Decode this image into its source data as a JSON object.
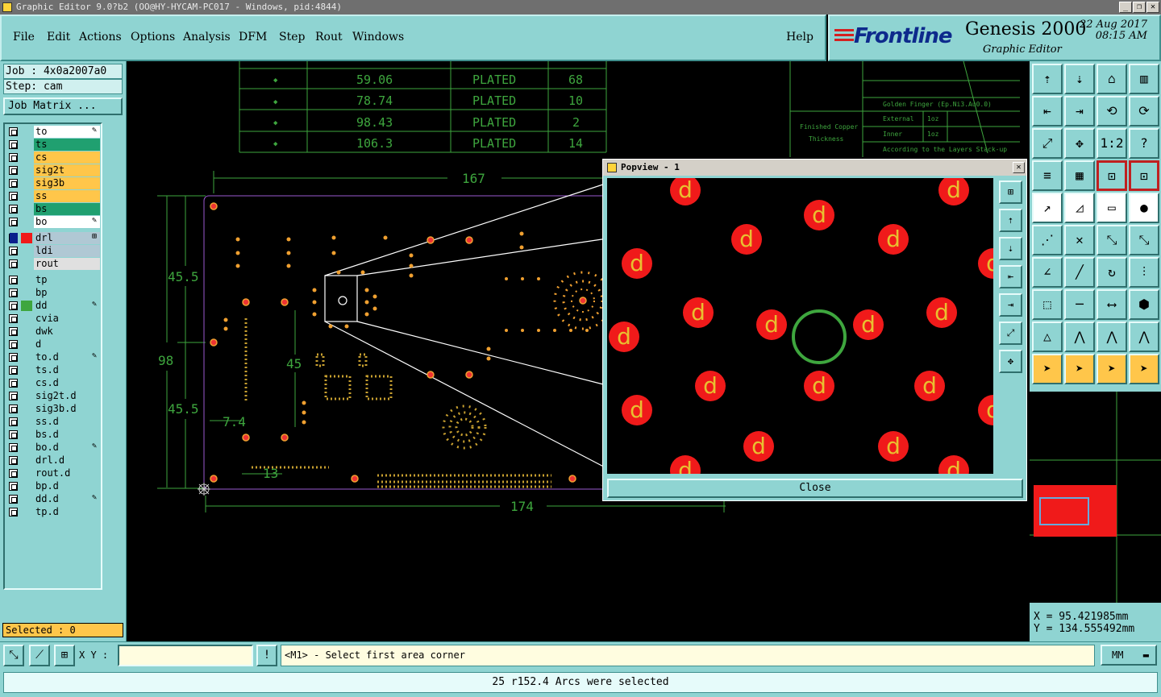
{
  "window": {
    "title": "Graphic Editor 9.0?b2 (OO@HY-HYCAM-PC017 - Windows, pid:4844)",
    "controls": [
      "_",
      "❐",
      "✕"
    ]
  },
  "menu": {
    "items": [
      "File",
      "Edit",
      "Actions",
      "Options",
      "Analysis",
      "DFM",
      "Step",
      "Rout",
      "Windows"
    ],
    "help": "Help"
  },
  "brand": {
    "logo": "Frontline",
    "product": "Genesis 2000",
    "subtitle": "Graphic Editor",
    "date": "22 Aug 2017",
    "time": "08:15 AM"
  },
  "job": {
    "job_label": "Job : 4x0a2007a0",
    "step_label": "Step: cam",
    "matrix_button": "Job Matrix ..."
  },
  "layers": [
    {
      "name": "to",
      "color": "#ffffff",
      "marker": "✎"
    },
    {
      "name": "ts",
      "color": "#20a070",
      "marker": ""
    },
    {
      "name": "cs",
      "color": "#ffc64a",
      "marker": ""
    },
    {
      "name": "sig2t",
      "color": "#ffc64a",
      "marker": ""
    },
    {
      "name": "sig3b",
      "color": "#ffc64a",
      "marker": ""
    },
    {
      "name": "ss",
      "color": "#ffc64a",
      "marker": ""
    },
    {
      "name": "bs",
      "color": "#20a070",
      "marker": ""
    },
    {
      "name": "bo",
      "color": "#ffffff",
      "marker": "✎"
    },
    {
      "name": "drl",
      "color": "#b0c8d4",
      "marker": "⊞"
    },
    {
      "name": "ldi",
      "color": "#b0c8d4",
      "marker": ""
    },
    {
      "name": "rout",
      "color": "#e0e0e0",
      "marker": ""
    },
    {
      "name": "tp",
      "color": "#8fd4d2",
      "marker": ""
    },
    {
      "name": "bp",
      "color": "#8fd4d2",
      "marker": ""
    },
    {
      "name": "dd",
      "color": "#8fd4d2",
      "marker": "✎"
    },
    {
      "name": "cvia",
      "color": "#8fd4d2",
      "marker": ""
    },
    {
      "name": "dwk",
      "color": "#8fd4d2",
      "marker": ""
    },
    {
      "name": "d",
      "color": "#8fd4d2",
      "marker": ""
    },
    {
      "name": "to.d",
      "color": "#8fd4d2",
      "marker": "✎"
    },
    {
      "name": "ts.d",
      "color": "#8fd4d2",
      "marker": ""
    },
    {
      "name": "cs.d",
      "color": "#8fd4d2",
      "marker": ""
    },
    {
      "name": "sig2t.d",
      "color": "#8fd4d2",
      "marker": ""
    },
    {
      "name": "sig3b.d",
      "color": "#8fd4d2",
      "marker": ""
    },
    {
      "name": "ss.d",
      "color": "#8fd4d2",
      "marker": ""
    },
    {
      "name": "bs.d",
      "color": "#8fd4d2",
      "marker": ""
    },
    {
      "name": "bo.d",
      "color": "#8fd4d2",
      "marker": "✎"
    },
    {
      "name": "drl.d",
      "color": "#8fd4d2",
      "marker": ""
    },
    {
      "name": "rout.d",
      "color": "#8fd4d2",
      "marker": ""
    },
    {
      "name": "bp.d",
      "color": "#8fd4d2",
      "marker": ""
    },
    {
      "name": "dd.d",
      "color": "#8fd4d2",
      "marker": "✎"
    },
    {
      "name": "tp.d",
      "color": "#8fd4d2",
      "marker": ""
    }
  ],
  "selected": "Selected : 0",
  "drill_table": {
    "rows": [
      {
        "size": "59.06",
        "type": "PLATED",
        "qty": "68"
      },
      {
        "size": "78.74",
        "type": "PLATED",
        "qty": "10"
      },
      {
        "size": "98.43",
        "type": "PLATED",
        "qty": "2"
      },
      {
        "size": "106.3",
        "type": "PLATED",
        "qty": "14"
      }
    ]
  },
  "dimensions": {
    "top": "167",
    "bottom": "174",
    "left_total": "98",
    "left_upper": "45.5",
    "left_lower": "45.5",
    "inner": "45",
    "small1": "7.4",
    "small2": "13"
  },
  "notes": {
    "copper": "Finished Copper",
    "thickness": "Thickness",
    "gold": "Golden Finger (Ep.Ni3.Au0.0)",
    "external": "External",
    "external_val": "1oz",
    "inner": "Inner",
    "inner_val": "1oz",
    "stackup": "According to the Layers Stack-up"
  },
  "popview": {
    "title": "Popview - 1",
    "close": "Close",
    "pad_label": "d"
  },
  "coords": {
    "x": "X = 95.421985mm",
    "y": "Y = 134.555492mm"
  },
  "bottom": {
    "xy_label": "X Y :",
    "prompt": "<M1> - Select first area corner",
    "units": "MM"
  },
  "status": "25 r152.4 Arcs were selected",
  "tools": [
    "⇡",
    "⇣",
    "⌂",
    "▥",
    "⇤",
    "⇥",
    "⟲",
    "⟳",
    "⤢",
    "✥",
    "1:2",
    "?",
    "≡",
    "▦",
    "⊡",
    "⊡",
    "↗",
    "◿",
    "▭",
    "●",
    "⋰",
    "✕",
    "⤡",
    "⤡",
    "∠",
    "╱",
    "↻",
    "⫶",
    "⬚",
    "─",
    "⟷",
    "⬢",
    "△",
    "⋀",
    "⋀",
    "⋀",
    "➤",
    "➤",
    "➤",
    "➤"
  ]
}
